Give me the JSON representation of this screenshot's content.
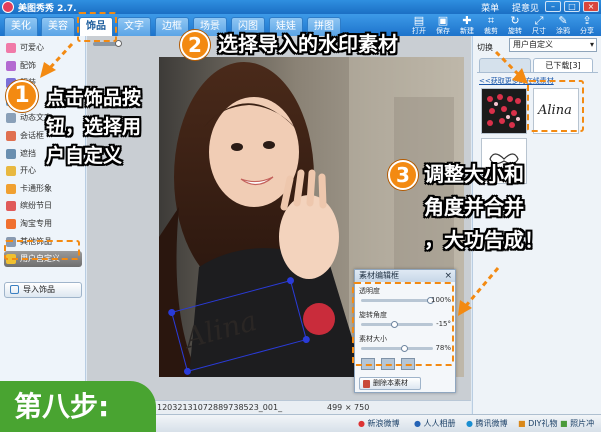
{
  "titlebar": {
    "title": "美图秀秀 2.7.",
    "links": [
      "菜单",
      "提意见"
    ]
  },
  "tabs": [
    "美化",
    "美容",
    "饰品",
    "文字",
    "边框",
    "场景",
    "闪图",
    "娃娃",
    "拼图"
  ],
  "tools": [
    {
      "label": "打开",
      "icon": "folder-icon"
    },
    {
      "label": "保存",
      "icon": "save-icon"
    },
    {
      "label": "新建",
      "icon": "new-icon"
    },
    {
      "label": "裁剪",
      "icon": "crop-icon"
    },
    {
      "label": "旋转",
      "icon": "rotate-icon"
    },
    {
      "label": "尺寸",
      "icon": "size-icon"
    },
    {
      "label": "涂鸦",
      "icon": "brush-icon"
    },
    {
      "label": "分享",
      "icon": "share-icon"
    }
  ],
  "left_items": [
    {
      "label": "可爱心",
      "color": "#f07aa8"
    },
    {
      "label": "配饰",
      "color": "#b36ad1"
    },
    {
      "label": "服装",
      "color": "#7a6fd8"
    },
    {
      "label": "",
      "color": "#5aa0e0"
    },
    {
      "label": "动态文字",
      "color": "#8aa0b8"
    },
    {
      "label": "会话框",
      "color": "#e07050"
    },
    {
      "label": "遮挡",
      "color": "#6a8fb0"
    },
    {
      "label": "开心",
      "color": "#e8b840"
    },
    {
      "label": "卡通形象",
      "color": "#f0a030"
    },
    {
      "label": "缤纷节日",
      "color": "#e05a5a"
    },
    {
      "label": "淘宝专用",
      "color": "#f07030"
    },
    {
      "label": "其他饰品",
      "color": "#8a9ab0"
    },
    {
      "label": "用户自定义",
      "color": "#f0c030"
    }
  ],
  "left_import": "导入饰品",
  "right_panel": {
    "select_label": "切换",
    "select_value": "用户自定义",
    "tabs": [
      "",
      "已下载[3]"
    ],
    "link": "<<获取更多的在线素材",
    "watermark_text": "Alina"
  },
  "editor": {
    "title": "素材编辑框",
    "rows": [
      {
        "label": "透明度",
        "value": "100%",
        "level": 1.0
      },
      {
        "label": "旋转角度",
        "value": "-15°",
        "level": 0.46
      },
      {
        "label": "素材大小",
        "value": "78%",
        "level": 0.6
      }
    ],
    "delete_label": "删除本素材"
  },
  "status": {
    "filename": "120321310728897385​23_001_",
    "dims": "499 × 750"
  },
  "bottom_items": [
    "新浪微博",
    "人人相册",
    "腾讯微博",
    "DIY礼物",
    "照片冲印"
  ],
  "annotations": {
    "step1_num": "1",
    "step1_text": [
      "点击饰品按",
      "钮，选择用",
      "户自定义"
    ],
    "step2_num": "2",
    "step2_text": "选择导入的水印素材",
    "step3_num": "3",
    "step3_text": [
      "调整大小和",
      "角度并合并",
      "，大功告成！"
    ],
    "step_label": "第八步:"
  },
  "watermark_overlay": "Alina",
  "colors": {
    "accent": "#f38a12",
    "step_green": "#49a431",
    "blue": "#1d73cb"
  }
}
